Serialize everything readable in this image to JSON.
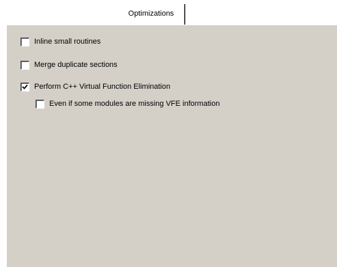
{
  "tabs": [
    {
      "label": "Optimizations",
      "active": true
    }
  ],
  "options": [
    {
      "label": "Inline small routines",
      "checked": false
    },
    {
      "label": "Merge duplicate sections",
      "checked": false
    },
    {
      "label": "Perform C++ Virtual Function Elimination",
      "checked": true
    },
    {
      "label": "Even if some modules are missing VFE information",
      "checked": false
    }
  ],
  "colors": {
    "panel_background": "#d4d0c8",
    "window_background": "#ffffff",
    "checkbox_fill": "#ffffff",
    "check_mark": "#000000"
  }
}
